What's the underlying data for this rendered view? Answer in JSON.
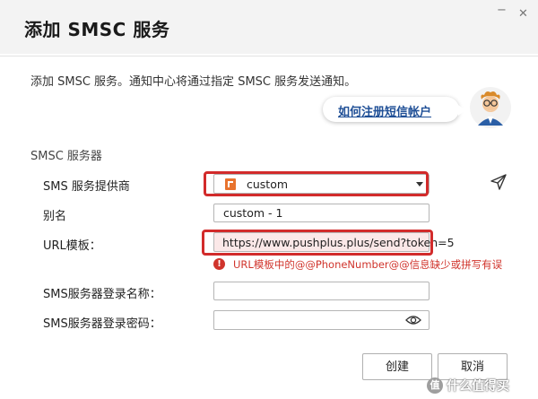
{
  "dialog": {
    "title": "添加 SMSC 服务",
    "intro": "添加 SMSC 服务。通知中心将通过指定 SMSC 服务发送通知。",
    "help_link": "如何注册短信帐户",
    "section_title": "SMSC 服务器",
    "window_controls": {
      "minimize": "−",
      "close": "✕"
    }
  },
  "form": {
    "provider_label": "SMS 服务提供商",
    "provider_value": "custom",
    "alias_label": "别名",
    "alias_value": "custom - 1",
    "url_label": "URL模板：",
    "url_value": "https://www.pushplus.plus/send?token=5",
    "url_error_icon": "!",
    "url_error": "URL模板中的@@PhoneNumber@@信息缺少或拼写有误",
    "login_label": "SMS服务器登录名称：",
    "login_value": "",
    "password_label": "SMS服务器登录密码：",
    "password_value": ""
  },
  "buttons": {
    "create": "创建",
    "cancel": "取消"
  },
  "watermark": {
    "badge": "值",
    "text": "什么值得买"
  },
  "colors": {
    "error": "#d0342c",
    "highlight": "#d22b2b",
    "link": "#1f4f96",
    "url_field_bg": "#fbe8e8"
  },
  "icons": [
    "provider-logo-icon",
    "caret-down-icon",
    "send-test-icon",
    "eye-icon",
    "error-icon",
    "mascot-icon"
  ]
}
